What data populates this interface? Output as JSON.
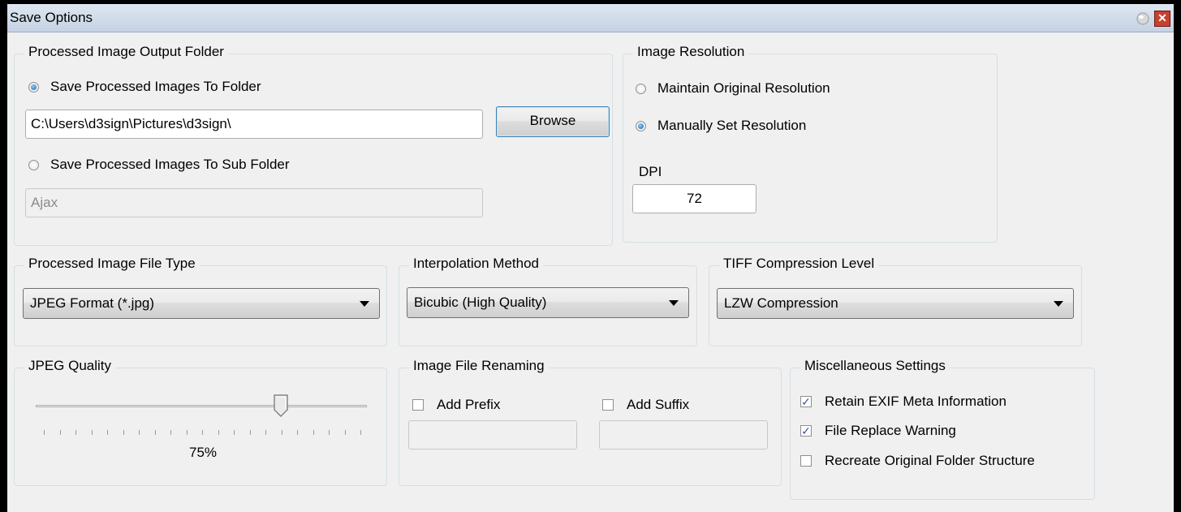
{
  "window": {
    "title": "Save Options"
  },
  "output_folder": {
    "legend": "Processed Image Output Folder",
    "option_folder": "Save Processed Images To Folder",
    "folder_path": "C:\\Users\\d3sign\\Pictures\\d3sign\\",
    "browse_label": "Browse",
    "option_subfolder": "Save Processed Images To Sub Folder",
    "subfolder_name": "Ajax",
    "selected": "folder"
  },
  "resolution": {
    "legend": "Image Resolution",
    "option_original": "Maintain Original Resolution",
    "option_manual": "Manually Set Resolution",
    "dpi_label": "DPI",
    "dpi_value": "72",
    "selected": "manual"
  },
  "file_type": {
    "legend": "Processed Image File Type",
    "selected": "JPEG Format (*.jpg)"
  },
  "interpolation": {
    "legend": "Interpolation Method",
    "selected": "Bicubic (High Quality)"
  },
  "tiff": {
    "legend": "TIFF Compression Level",
    "selected": "LZW Compression"
  },
  "jpeg_quality": {
    "legend": "JPEG Quality",
    "value_text": "75%",
    "value": 75,
    "tick_count": 21
  },
  "renaming": {
    "legend": "Image File Renaming",
    "prefix_label": "Add Prefix",
    "prefix_checked": false,
    "prefix_value": "",
    "suffix_label": "Add Suffix",
    "suffix_checked": false,
    "suffix_value": ""
  },
  "misc": {
    "legend": "Miscellaneous Settings",
    "items": [
      {
        "label": "Retain EXIF Meta Information",
        "checked": true
      },
      {
        "label": "File Replace Warning",
        "checked": true
      },
      {
        "label": "Recreate Original Folder Structure",
        "checked": false
      }
    ]
  },
  "colors": {
    "accent": "#1c5fa8",
    "titlebar": "#c4d2e3",
    "dialog_bg": "#f0f0f0"
  }
}
